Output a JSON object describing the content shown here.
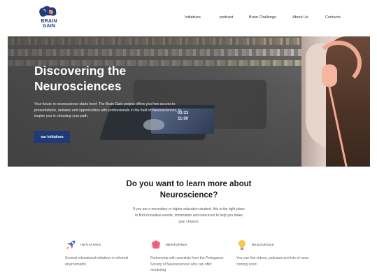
{
  "logo": {
    "line1": "BRAIN",
    "line2": "GAIN"
  },
  "nav": {
    "items": [
      "Initiatives",
      "podcast",
      "Brain Challenge",
      "About Us",
      "Contacts"
    ]
  },
  "hero": {
    "title_line1": "Discovering the",
    "title_line2": "Neurosciences",
    "text": "Your future in neuroscience starts here! The Brain Gain project offers you free access to presentations, debates and opportunities with professionals in the field of Neurosciences, to inspire you in choosing your path.",
    "button": "our Initiatives",
    "device_time1": "02:23",
    "device_time2": "11:00"
  },
  "section": {
    "title": "Do you want to learn more about Neuroscience?",
    "text": "If you are a secondary or higher education student, this is the right place to find innovative events, information and resources to help you make your choices."
  },
  "features": [
    {
      "icon": "rocket-icon",
      "title": "INITIATIVES",
      "text": "Several educational initiatives in informal environments"
    },
    {
      "icon": "brain-icon",
      "title": "MENTORING",
      "text": "Partnership with scientists from the Portuguese Society of Neurosciences who can offer mentoring"
    },
    {
      "icon": "lightbulb-icon",
      "title": "RESOURCES",
      "text": "You can find videos, podcasts and lots of news coming soon!"
    }
  ],
  "colors": {
    "accent": "#1f3a78",
    "brand_orange": "#f08a5d",
    "headphone": "#f0a88f"
  }
}
